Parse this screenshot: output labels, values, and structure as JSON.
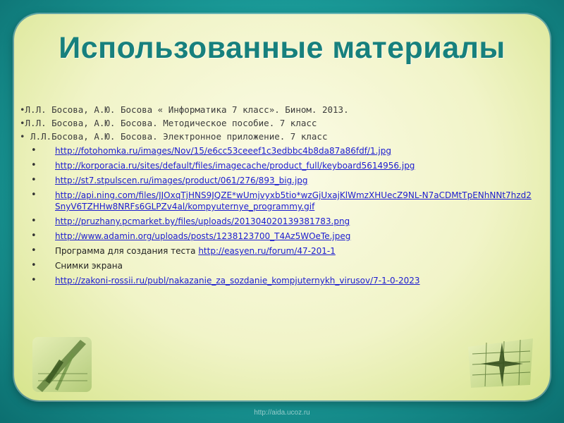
{
  "slide": {
    "title": "Использованные материалы",
    "references": [
      "•Л.Л. Босова, А.Ю. Босова « Информатика 7 класс». Бином. 2013.",
      "•Л.Л. Босова, А.Ю. Босова. Методическое пособие. 7 класс",
      "• Л.Л.Босова, А.Ю. Босова. Электронное приложение. 7 класс"
    ],
    "links": [
      {
        "prefix": "",
        "url": "http://fotohomka.ru/images/Nov/15/e6cc53ceeef1c3edbbc4b8da87a86fdf/1.jpg"
      },
      {
        "prefix": "",
        "url": "http://korporacia.ru/sites/default/files/imagecache/product_full/keyboard5614956.jpg"
      },
      {
        "prefix": "",
        "url": "http://st7.stpulscen.ru/images/product/061/276/893_big.jpg"
      },
      {
        "prefix": "",
        "url": "http://api.ning.com/files/JJOxqTjHNS9JQZE*wUmjvyxb5tio*wzGjUxajKlWmzXHUecZ9NL-N7aCDMtTpENhNNt7hzd2SnyV6TZHHw8NRFs6GLPZv4al/kompyuternye_programmy.gif"
      },
      {
        "prefix": "",
        "url": "http://pruzhany.pcmarket.by/files/uploads/201304020139381783.png"
      },
      {
        "prefix": "",
        "url": "http://www.adamin.org/uploads/posts/1238123700_T4Az5WOeTe.jpeg"
      },
      {
        "prefix": "Программа для создания теста ",
        "url": "http://easyen.ru/forum/47-201-1"
      },
      {
        "prefix": "Снимки экрана",
        "url": ""
      },
      {
        "prefix": "",
        "url": "http://zakoni-rossii.ru/publ/nakazanie_za_sozdanie_kompjuternykh_virusov/7-1-0-2023"
      }
    ],
    "footer": "http://aida.ucoz.ru",
    "colors": {
      "title": "#17807d",
      "link": "#1c1cd0",
      "background": "#1a9a98",
      "panel": "#f1f4c8"
    },
    "icons": {
      "left": "drafting-tools-icon",
      "right": "compass-rose-icon"
    }
  }
}
